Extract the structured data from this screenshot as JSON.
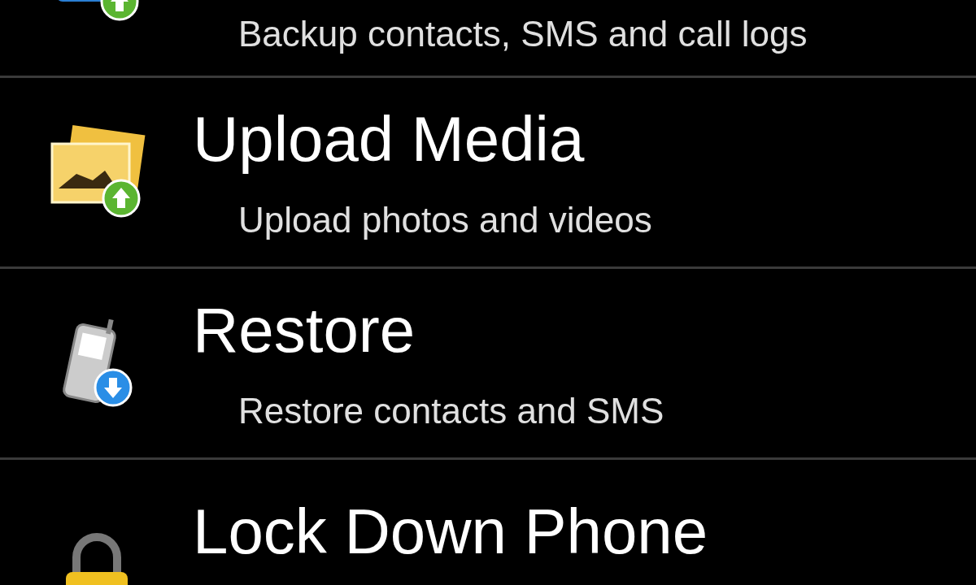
{
  "menu": {
    "items": [
      {
        "kind": "backup",
        "subtitle": "Backup contacts, SMS and call logs"
      },
      {
        "kind": "media",
        "title": "Upload Media",
        "subtitle": "Upload photos and videos"
      },
      {
        "kind": "restore",
        "title": "Restore",
        "subtitle": "Restore contacts and SMS"
      },
      {
        "kind": "lock",
        "title": "Lock Down Phone"
      }
    ]
  }
}
